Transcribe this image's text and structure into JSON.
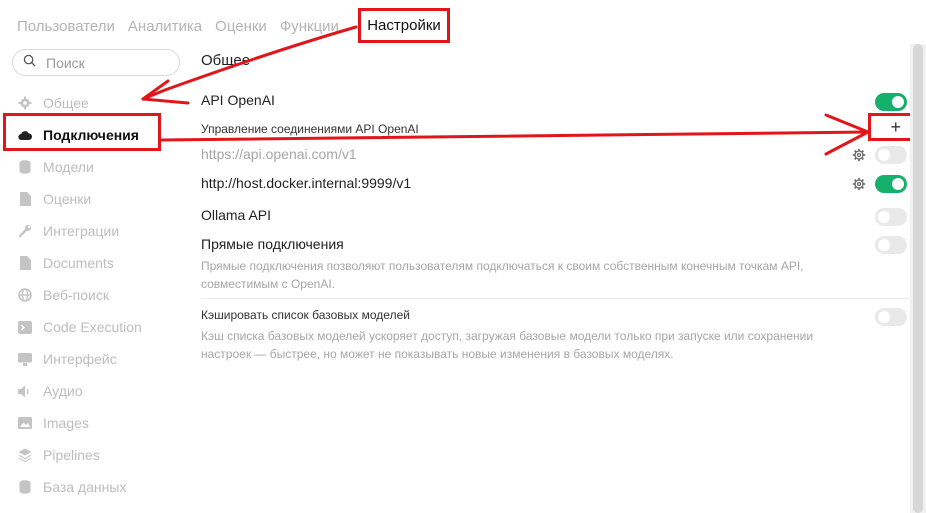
{
  "tabs": [
    "Пользователи",
    "Аналитика",
    "Оценки",
    "Функции",
    "Настройки"
  ],
  "search": {
    "placeholder": "Поиск"
  },
  "sidebar": {
    "items": [
      {
        "label": "Общее",
        "icon": "gear-icon"
      },
      {
        "label": "Подключения",
        "icon": "cloud-icon",
        "active": true
      },
      {
        "label": "Модели",
        "icon": "database-icon"
      },
      {
        "label": "Оценки",
        "icon": "document-icon"
      },
      {
        "label": "Интеграции",
        "icon": "wrench-icon"
      },
      {
        "label": "Documents",
        "icon": "document-icon"
      },
      {
        "label": "Веб-поиск",
        "icon": "globe-icon"
      },
      {
        "label": "Code Execution",
        "icon": "terminal-icon"
      },
      {
        "label": "Интерфейс",
        "icon": "monitor-icon"
      },
      {
        "label": "Аудио",
        "icon": "speaker-icon"
      },
      {
        "label": "Images",
        "icon": "image-icon"
      },
      {
        "label": "Pipelines",
        "icon": "layers-icon"
      },
      {
        "label": "База данных",
        "icon": "database-icon"
      }
    ]
  },
  "main": {
    "section_title": "Общее",
    "openai": {
      "label": "API OpenAI",
      "enabled": true,
      "manage_label": "Управление соединениями API OpenAI",
      "connections": [
        {
          "url": "https://api.openai.com/v1",
          "enabled": false
        },
        {
          "url": "http://host.docker.internal:9999/v1",
          "enabled": true
        }
      ]
    },
    "ollama": {
      "label": "Ollama API",
      "enabled": false
    },
    "direct": {
      "label": "Прямые подключения",
      "enabled": false,
      "description": "Прямые подключения позволяют пользователям подключаться к своим собственным конечным точкам API, совместимым с OpenAI."
    },
    "cache": {
      "label": "Кэшировать список базовых моделей",
      "enabled": false,
      "description": "Кэш списка базовых моделей ускоряет доступ, загружая базовые модели только при запуске или сохранении настроек — быстрее, но может не показывать новые изменения в базовых моделях."
    }
  },
  "colors": {
    "accent_green": "#16b06d",
    "annotation_red": "#e0161b"
  }
}
